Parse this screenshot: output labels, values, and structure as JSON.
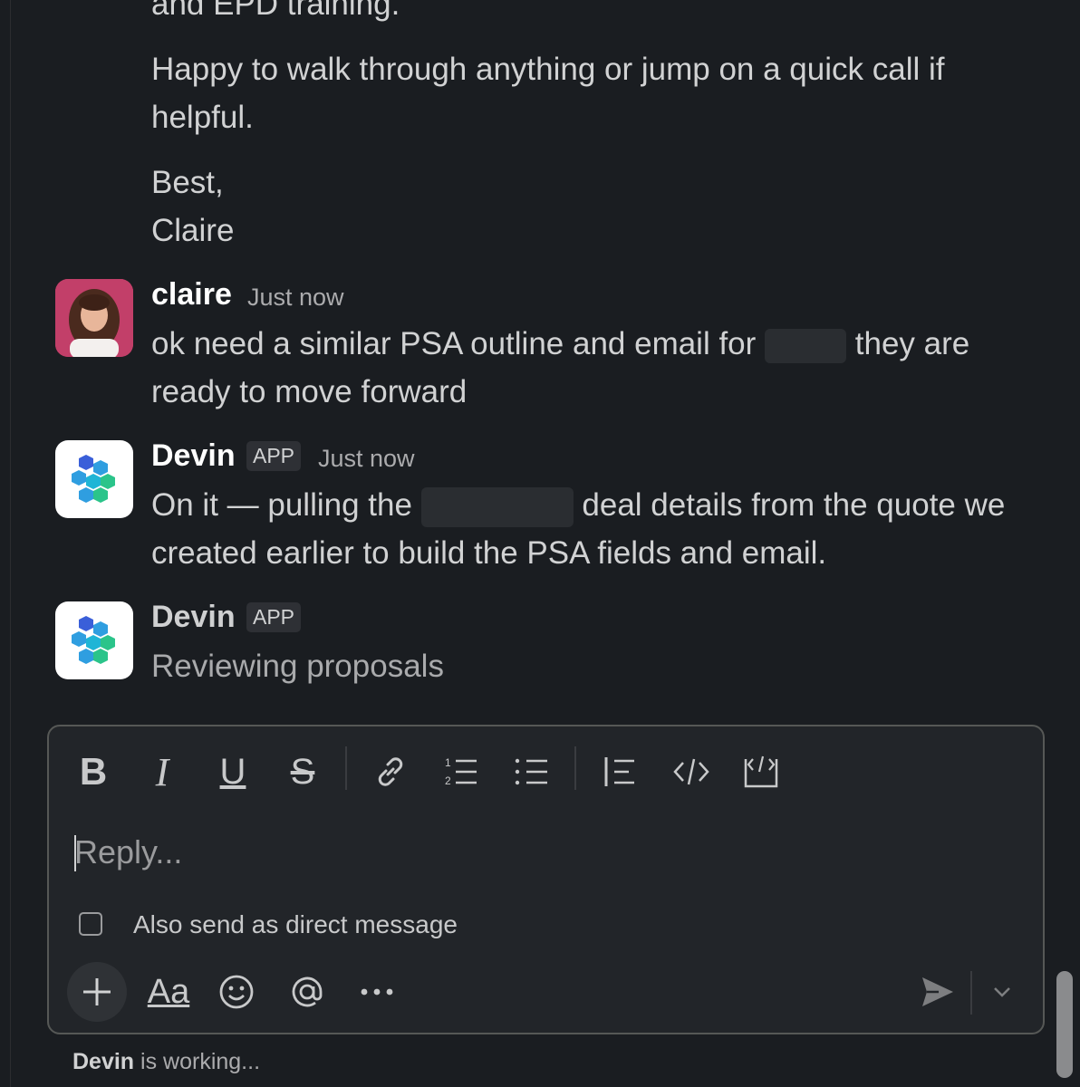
{
  "messages": {
    "top_fragment": "and EPD training.",
    "paragraph_1": "Happy to walk through anything or jump on a quick call if helpful.",
    "sign_off": "Best,",
    "signature": "Claire",
    "claire": {
      "author": "claire",
      "time": "Just now",
      "text_before": "ok need a similar PSA outline and email for",
      "text_after": "they are ready to move forward"
    },
    "devin_1": {
      "author": "Devin",
      "badge": "APP",
      "time": "Just now",
      "text_before": "On it — pulling the",
      "text_after": "deal details from the quote we created earlier to build the PSA fields and email."
    },
    "devin_2": {
      "author": "Devin",
      "badge": "APP",
      "status_text": "Reviewing proposals"
    }
  },
  "composer": {
    "placeholder": "Reply...",
    "also_send_label": "Also send as direct message",
    "toolbar_icons": [
      "bold-icon",
      "italic-icon",
      "underline-icon",
      "strikethrough-icon",
      "link-icon",
      "ordered-list-icon",
      "bullet-list-icon",
      "blockquote-icon",
      "code-icon",
      "code-block-icon"
    ],
    "bottom_icons": [
      "plus-icon",
      "formatting-icon",
      "emoji-icon",
      "mention-icon",
      "more-icon",
      "send-icon",
      "chevron-down-icon"
    ],
    "format_label": "Aa"
  },
  "status_bar": {
    "name": "Devin",
    "text": " is working..."
  },
  "colors": {
    "background": "#1a1d21",
    "composer_bg": "#222529",
    "text": "#d1d2d3",
    "accent_avatar": "#c9426a"
  }
}
